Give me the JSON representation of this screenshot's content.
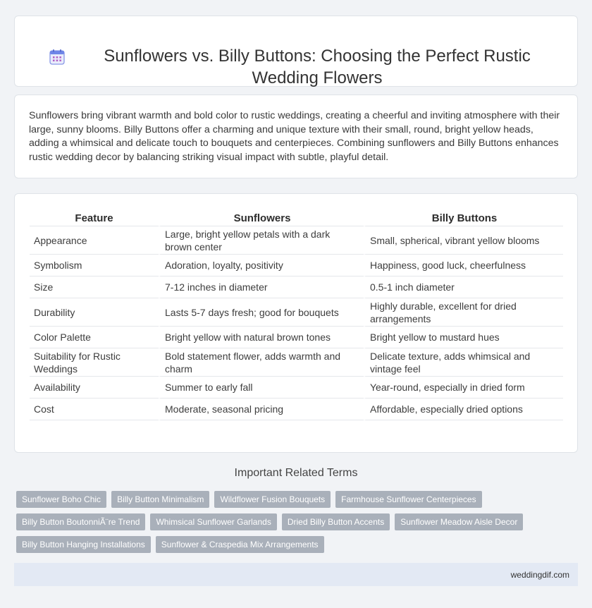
{
  "header": {
    "title": "Sunflowers vs. Billy Buttons: Choosing the Perfect Rustic Wedding Flowers",
    "icon": "calendar-icon"
  },
  "intro": {
    "text": "Sunflowers bring vibrant warmth and bold color to rustic weddings, creating a cheerful and inviting atmosphere with their large, sunny blooms. Billy Buttons offer a charming and unique texture with their small, round, bright yellow heads, adding a whimsical and delicate touch to bouquets and centerpieces. Combining sunflowers and Billy Buttons enhances rustic wedding decor by balancing striking visual impact with subtle, playful detail."
  },
  "table": {
    "headers": [
      "Feature",
      "Sunflowers",
      "Billy Buttons"
    ],
    "rows": [
      [
        "Appearance",
        "Large, bright yellow petals with a dark brown center",
        "Small, spherical, vibrant yellow blooms"
      ],
      [
        "Symbolism",
        "Adoration, loyalty, positivity",
        "Happiness, good luck, cheerfulness"
      ],
      [
        "Size",
        "7-12 inches in diameter",
        "0.5-1 inch diameter"
      ],
      [
        "Durability",
        "Lasts 5-7 days fresh; good for bouquets",
        "Highly durable, excellent for dried arrangements"
      ],
      [
        "Color Palette",
        "Bright yellow with natural brown tones",
        "Bright yellow to mustard hues"
      ],
      [
        "Suitability for Rustic Weddings",
        "Bold statement flower, adds warmth and charm",
        "Delicate texture, adds whimsical and vintage feel"
      ],
      [
        "Availability",
        "Summer to early fall",
        "Year-round, especially in dried form"
      ],
      [
        "Cost",
        "Moderate, seasonal pricing",
        "Affordable, especially dried options"
      ]
    ]
  },
  "related": {
    "heading": "Important Related Terms",
    "tags": [
      [
        "Sunflower Boho Chic",
        "Billy Button Minimalism",
        "Wildflower Fusion Bouquets",
        "Farmhouse Sunflower Centerpieces"
      ],
      [
        "Billy Button BoutonniÃ¨re Trend",
        "Whimsical Sunflower Garlands",
        "Dried Billy Button Accents",
        "Sunflower Meadow Aisle Decor"
      ],
      [
        "Billy Button Hanging Installations",
        "Sunflower & Craspedia Mix Arrangements"
      ]
    ]
  },
  "footer": {
    "text": "weddingdif.com"
  },
  "colors": {
    "background": "#f1f3f6",
    "tag_bg": "#a9b0ba",
    "footer_bg": "#e3e9f4",
    "icon_accent": "#7b8de0"
  }
}
